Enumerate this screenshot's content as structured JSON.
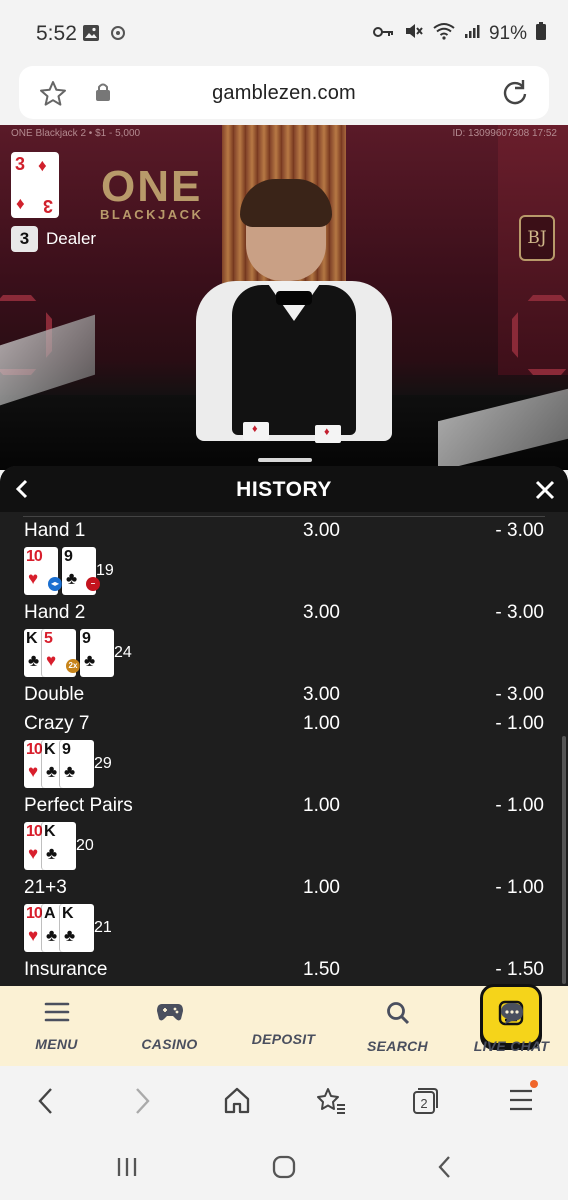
{
  "status_bar": {
    "time": "5:52",
    "battery": "91%"
  },
  "browser": {
    "url": "gamblezen.com",
    "tab_count": "2"
  },
  "video": {
    "table_info": "ONE Blackjack 2 • $1 - 5,000",
    "game_id": "ID: 13099607308 17:52",
    "dealer_card_rank": "3",
    "dealer_card_suit": "♦",
    "dealer_score": "3",
    "dealer_label": "Dealer",
    "brand_one": "ONE",
    "brand_blackjack": "BLACKJACK",
    "bj_badge": "BJ"
  },
  "history": {
    "title": "HISTORY",
    "rows": [
      {
        "name": "Hand 1",
        "bet": "3.00",
        "win": "- 3.00"
      },
      {
        "name": "Hand 2",
        "bet": "3.00",
        "win": "- 3.00"
      },
      {
        "name": "Double",
        "bet": "3.00",
        "win": "- 3.00"
      },
      {
        "name": "Crazy 7",
        "bet": "1.00",
        "win": "- 1.00"
      },
      {
        "name": "Perfect Pairs",
        "bet": "1.00",
        "win": "- 1.00"
      },
      {
        "name": "21+3",
        "bet": "1.00",
        "win": "- 1.00"
      },
      {
        "name": "Insurance",
        "bet": "1.50",
        "win": "- 1.50"
      }
    ],
    "hand1": {
      "cards": [
        {
          "rank": "10",
          "suit": "♥"
        },
        {
          "rank": "9",
          "suit": "♣"
        }
      ],
      "total": "19"
    },
    "hand2": {
      "cards": [
        {
          "rank": "K",
          "suit": "♣"
        },
        {
          "rank": "5",
          "suit": "♥"
        },
        {
          "rank": "9",
          "suit": "♣"
        }
      ],
      "total": "24",
      "chip": "2x"
    },
    "crazy7": {
      "cards": [
        {
          "rank": "10",
          "suit": "♥"
        },
        {
          "rank": "K",
          "suit": "♣"
        },
        {
          "rank": "9",
          "suit": "♣"
        }
      ],
      "total": "29"
    },
    "perfect_pairs": {
      "cards": [
        {
          "rank": "10",
          "suit": "♥"
        },
        {
          "rank": "K",
          "suit": "♣"
        }
      ],
      "total": "20"
    },
    "twentyone_three": {
      "cards": [
        {
          "rank": "10",
          "suit": "♥"
        },
        {
          "rank": "A",
          "suit": "♣"
        },
        {
          "rank": "K",
          "suit": "♣"
        }
      ],
      "total": "21"
    }
  },
  "bottom_nav": {
    "menu": "MENU",
    "casino": "CASINO",
    "deposit": "DEPOSIT",
    "search": "SEARCH",
    "live_chat": "LIVE CHAT"
  },
  "colors": {
    "deposit_yellow": "#f5d41a",
    "nav_bg": "#fbf1d4",
    "card_red": "#d81e2c",
    "panel_bg": "#1e1e1e"
  }
}
